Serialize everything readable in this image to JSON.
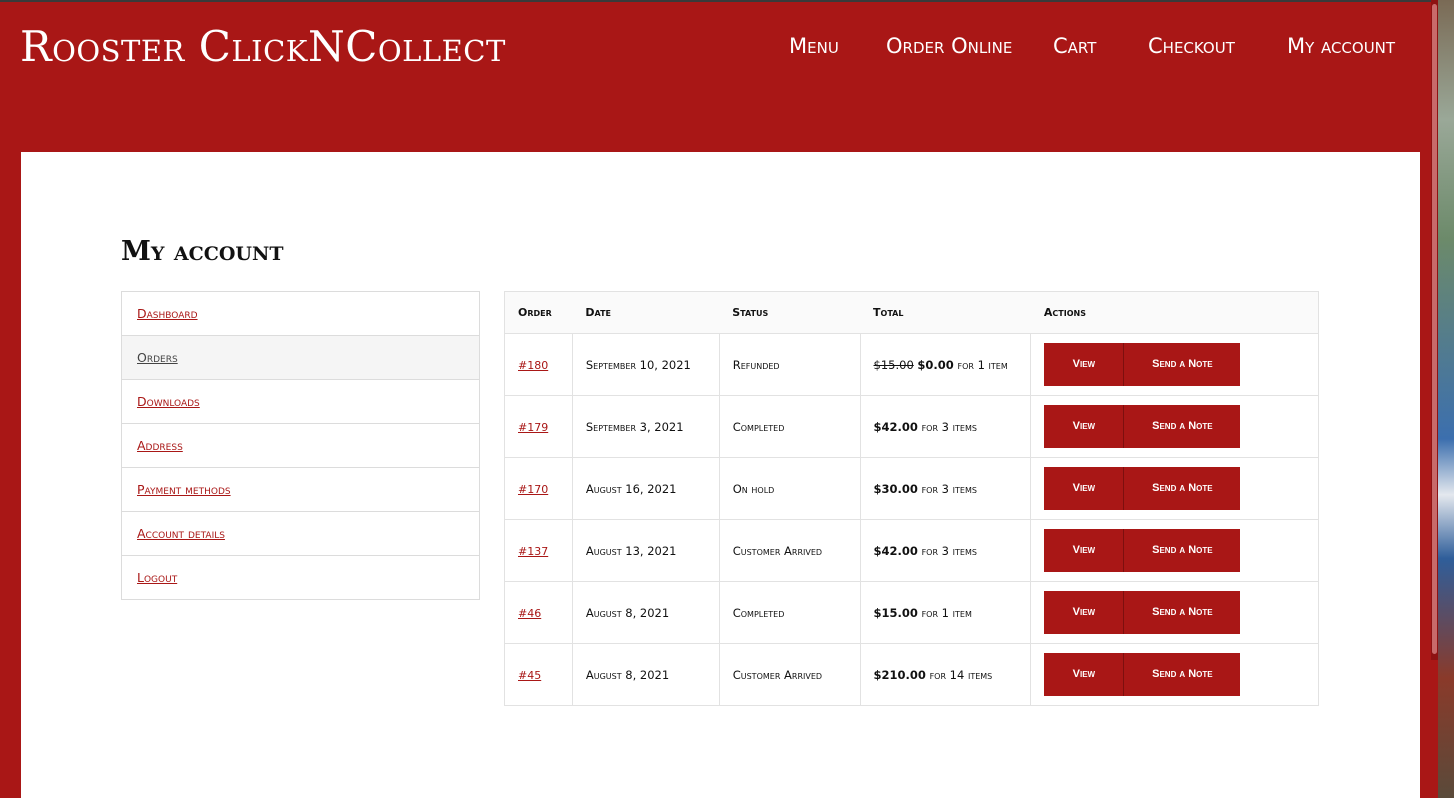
{
  "site": {
    "title": "Rooster ClickNCollect"
  },
  "nav": [
    "Menu",
    "Order Online",
    "Cart",
    "Checkout",
    "My account"
  ],
  "page": {
    "title": "My account"
  },
  "sidebar": {
    "items": [
      {
        "label": "Dashboard"
      },
      {
        "label": "Orders"
      },
      {
        "label": "Downloads"
      },
      {
        "label": "Address"
      },
      {
        "label": "Payment methods"
      },
      {
        "label": "Account details"
      },
      {
        "label": "Logout"
      }
    ]
  },
  "orders": {
    "headers": [
      "Order",
      "Date",
      "Status",
      "Total",
      "Actions"
    ],
    "view_label": "View",
    "note_label": "Send a Note",
    "rows": [
      {
        "order": "#180",
        "date": "September 10, 2021",
        "status": "Refunded",
        "original": "$15.00",
        "total": "$0.00",
        "items": "for 1 item"
      },
      {
        "order": "#179",
        "date": "September 3, 2021",
        "status": "Completed",
        "original": "",
        "total": "$42.00",
        "items": "for 3 items"
      },
      {
        "order": "#170",
        "date": "August 16, 2021",
        "status": "On hold",
        "original": "",
        "total": "$30.00",
        "items": "for 3 items"
      },
      {
        "order": "#137",
        "date": "August 13, 2021",
        "status": "Customer Arrived",
        "original": "",
        "total": "$42.00",
        "items": "for 3 items"
      },
      {
        "order": "#46",
        "date": "August 8, 2021",
        "status": "Completed",
        "original": "",
        "total": "$15.00",
        "items": "for 1 item"
      },
      {
        "order": "#45",
        "date": "August 8, 2021",
        "status": "Customer Arrived",
        "original": "",
        "total": "$210.00",
        "items": "for 14 items"
      }
    ]
  },
  "colors": {
    "brand": "#a91716",
    "panel": "#ffffff"
  }
}
